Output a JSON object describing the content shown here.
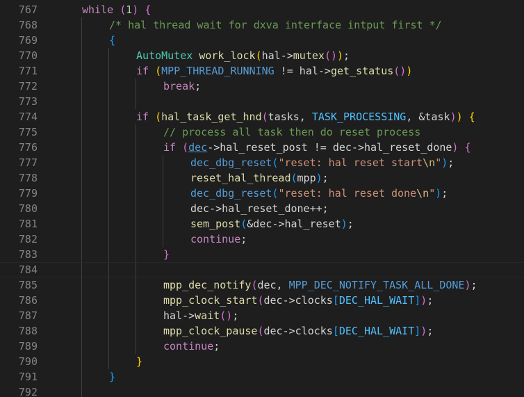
{
  "editor": {
    "theme": {
      "background": "#1e1e1e",
      "line_number": "#858585",
      "keyword": "#c586c0",
      "number": "#b5cea8",
      "comment": "#6a9955",
      "type": "#4ec9b0",
      "function": "#dcdcaa",
      "macro": "#569cd6",
      "constant": "#4fc1ff",
      "variable": "#9cdcfe",
      "string": "#ce9178",
      "escape": "#d7ba7d",
      "bracket_1": "#ffd700",
      "bracket_2": "#da70d6",
      "bracket_3": "#179fff"
    },
    "current_line": "784",
    "lines": [
      {
        "num": "767",
        "indent": 1,
        "tokens": [
          [
            "kw",
            "while"
          ],
          [
            "pn",
            " "
          ],
          [
            "b2",
            "("
          ],
          [
            "num",
            "1"
          ],
          [
            "b2",
            ")"
          ],
          [
            "pn",
            " "
          ],
          [
            "b2",
            "{"
          ]
        ]
      },
      {
        "num": "768",
        "indent": 2,
        "tokens": [
          [
            "cm",
            "/* hal thread wait for dxva interface intput first */"
          ]
        ]
      },
      {
        "num": "769",
        "indent": 2,
        "tokens": [
          [
            "b3",
            "{"
          ]
        ]
      },
      {
        "num": "770",
        "indent": 3,
        "tokens": [
          [
            "ty",
            "AutoMutex"
          ],
          [
            "pn",
            " "
          ],
          [
            "fn",
            "work_lock"
          ],
          [
            "b1",
            "("
          ],
          [
            "pn",
            "hal->"
          ],
          [
            "fn",
            "mutex"
          ],
          [
            "b2",
            "()"
          ],
          [
            "b1",
            ")"
          ],
          [
            "pn",
            ";"
          ]
        ]
      },
      {
        "num": "771",
        "indent": 3,
        "tokens": [
          [
            "kw",
            "if"
          ],
          [
            "pn",
            " "
          ],
          [
            "b1",
            "("
          ],
          [
            "mac",
            "MPP_THREAD_RUNNING"
          ],
          [
            "pn",
            " != hal->"
          ],
          [
            "fn",
            "get_status"
          ],
          [
            "b2",
            "()"
          ],
          [
            "b1",
            ")"
          ]
        ]
      },
      {
        "num": "772",
        "indent": 4,
        "tokens": [
          [
            "kw",
            "break"
          ],
          [
            "pn",
            ";"
          ]
        ]
      },
      {
        "num": "773",
        "indent": 0,
        "tokens": []
      },
      {
        "num": "774",
        "indent": 3,
        "tokens": [
          [
            "kw",
            "if"
          ],
          [
            "pn",
            " "
          ],
          [
            "b1",
            "("
          ],
          [
            "fn",
            "hal_task_get_hnd"
          ],
          [
            "b2",
            "("
          ],
          [
            "pn",
            "tasks, "
          ],
          [
            "cst",
            "TASK_PROCESSING"
          ],
          [
            "pn",
            ", &task"
          ],
          [
            "b2",
            ")"
          ],
          [
            "b1",
            ")"
          ],
          [
            "pn",
            " "
          ],
          [
            "b1",
            "{"
          ]
        ]
      },
      {
        "num": "775",
        "indent": 4,
        "tokens": [
          [
            "cm",
            "// process all task then do reset process"
          ]
        ]
      },
      {
        "num": "776",
        "indent": 4,
        "tokens": [
          [
            "kw",
            "if"
          ],
          [
            "pn",
            " "
          ],
          [
            "b2",
            "("
          ],
          [
            "mac ul",
            "dec"
          ],
          [
            "pn",
            "->hal_reset_post != dec->hal_reset_done"
          ],
          [
            "b2",
            ")"
          ],
          [
            "pn",
            " "
          ],
          [
            "b2",
            "{"
          ]
        ]
      },
      {
        "num": "777",
        "indent": 5,
        "tokens": [
          [
            "mac",
            "dec_dbg_reset"
          ],
          [
            "b3",
            "("
          ],
          [
            "str",
            "\"reset: hal reset start"
          ],
          [
            "esc",
            "\\n"
          ],
          [
            "str",
            "\""
          ],
          [
            "b3",
            ")"
          ],
          [
            "pn",
            ";"
          ]
        ]
      },
      {
        "num": "778",
        "indent": 5,
        "tokens": [
          [
            "fn",
            "reset_hal_thread"
          ],
          [
            "b3",
            "("
          ],
          [
            "pn",
            "mpp"
          ],
          [
            "b3",
            ")"
          ],
          [
            "pn",
            ";"
          ]
        ]
      },
      {
        "num": "779",
        "indent": 5,
        "tokens": [
          [
            "mac",
            "dec_dbg_reset"
          ],
          [
            "b3",
            "("
          ],
          [
            "str",
            "\"reset: hal reset done"
          ],
          [
            "esc",
            "\\n"
          ],
          [
            "str",
            "\""
          ],
          [
            "b3",
            ")"
          ],
          [
            "pn",
            ";"
          ]
        ]
      },
      {
        "num": "780",
        "indent": 5,
        "tokens": [
          [
            "pn",
            "dec->hal_reset_done++;"
          ]
        ]
      },
      {
        "num": "781",
        "indent": 5,
        "tokens": [
          [
            "fn",
            "sem_post"
          ],
          [
            "b3",
            "("
          ],
          [
            "pn",
            "&dec->hal_reset"
          ],
          [
            "b3",
            ")"
          ],
          [
            "pn",
            ";"
          ]
        ]
      },
      {
        "num": "782",
        "indent": 5,
        "tokens": [
          [
            "kw",
            "continue"
          ],
          [
            "pn",
            ";"
          ]
        ]
      },
      {
        "num": "783",
        "indent": 4,
        "tokens": [
          [
            "b2",
            "}"
          ]
        ]
      },
      {
        "num": "784",
        "indent": 0,
        "tokens": []
      },
      {
        "num": "785",
        "indent": 4,
        "tokens": [
          [
            "fn",
            "mpp_dec_notify"
          ],
          [
            "b2",
            "("
          ],
          [
            "pn",
            "dec, "
          ],
          [
            "mac",
            "MPP_DEC_NOTIFY_TASK_ALL_DONE"
          ],
          [
            "b2",
            ")"
          ],
          [
            "pn",
            ";"
          ]
        ]
      },
      {
        "num": "786",
        "indent": 4,
        "tokens": [
          [
            "fn",
            "mpp_clock_start"
          ],
          [
            "b2",
            "("
          ],
          [
            "pn",
            "dec->clocks"
          ],
          [
            "b3",
            "["
          ],
          [
            "cst",
            "DEC_HAL_WAIT"
          ],
          [
            "b3",
            "]"
          ],
          [
            "b2",
            ")"
          ],
          [
            "pn",
            ";"
          ]
        ]
      },
      {
        "num": "787",
        "indent": 4,
        "tokens": [
          [
            "pn",
            "hal->"
          ],
          [
            "fn",
            "wait"
          ],
          [
            "b2",
            "()"
          ],
          [
            "pn",
            ";"
          ]
        ]
      },
      {
        "num": "788",
        "indent": 4,
        "tokens": [
          [
            "fn",
            "mpp_clock_pause"
          ],
          [
            "b2",
            "("
          ],
          [
            "pn",
            "dec->clocks"
          ],
          [
            "b3",
            "["
          ],
          [
            "cst",
            "DEC_HAL_WAIT"
          ],
          [
            "b3",
            "]"
          ],
          [
            "b2",
            ")"
          ],
          [
            "pn",
            ";"
          ]
        ]
      },
      {
        "num": "789",
        "indent": 4,
        "tokens": [
          [
            "kw",
            "continue"
          ],
          [
            "pn",
            ";"
          ]
        ]
      },
      {
        "num": "790",
        "indent": 3,
        "tokens": [
          [
            "b1",
            "}"
          ]
        ]
      },
      {
        "num": "791",
        "indent": 2,
        "tokens": [
          [
            "b3",
            "}"
          ]
        ]
      },
      {
        "num": "792",
        "indent": 0,
        "tokens": []
      }
    ]
  }
}
